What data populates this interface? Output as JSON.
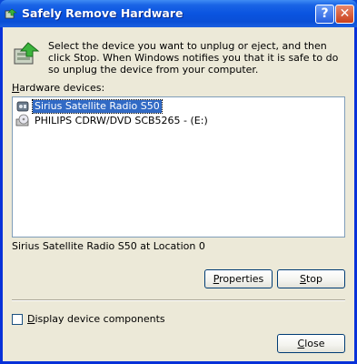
{
  "window": {
    "title": "Safely Remove Hardware",
    "help_button": "?",
    "close_button": "✕"
  },
  "instructions": "Select the device you want to unplug or eject, and then click Stop. When Windows notifies you that it is safe to do so unplug the device from your computer.",
  "hardware_label": "Hardware devices:",
  "devices": [
    {
      "label": "Sirius Satellite Radio S50",
      "icon": "usb-device-icon",
      "selected": true
    },
    {
      "label": "PHILIPS CDRW/DVD SCB5265 - (E:)",
      "icon": "cd-drive-icon",
      "selected": false
    }
  ],
  "status_text": "Sirius Satellite Radio S50 at Location 0",
  "buttons": {
    "properties": "Properties",
    "stop": "Stop",
    "close": "Close"
  },
  "display_components_label": "Display device components",
  "display_components_checked": false
}
